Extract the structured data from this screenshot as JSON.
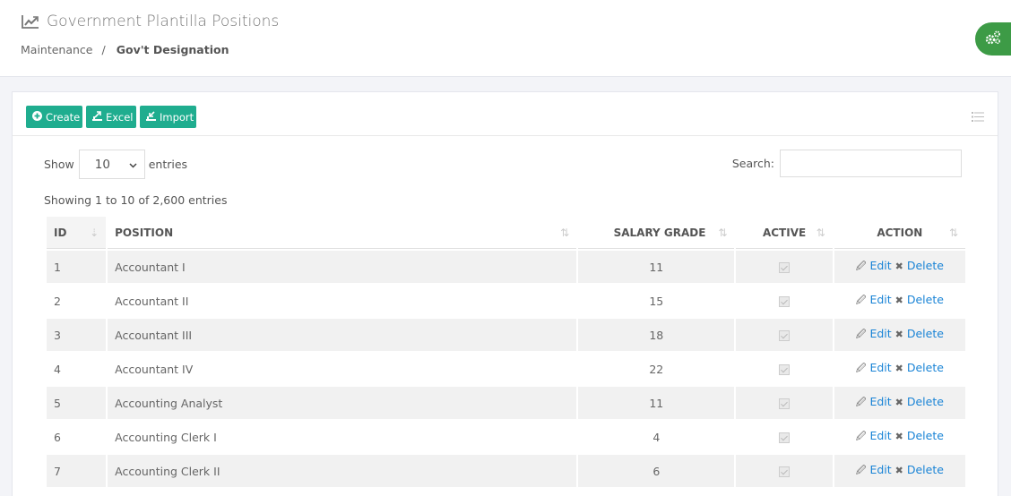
{
  "header": {
    "title": "Government Plantilla Positions",
    "title_icon": "line-chart-icon",
    "breadcrumb": [
      {
        "label": "Maintenance"
      },
      {
        "label": "Gov't Designation"
      }
    ],
    "breadcrumb_separator": "/"
  },
  "settings_toggle": {
    "icon": "gears-icon",
    "color": "#3d9b46"
  },
  "toolbar": {
    "create_label": "Create",
    "excel_label": "Excel",
    "import_label": "Import",
    "button_color": "#1fad8f",
    "columns_icon": "list-icon"
  },
  "length": {
    "show_label": "Show",
    "value": "10",
    "entries_label": "entries"
  },
  "search": {
    "label": "Search:",
    "value": "",
    "placeholder": ""
  },
  "info": "Showing 1 to 10 of 2,600 entries",
  "table": {
    "columns": [
      "ID",
      "POSITION",
      "SALARY GRADE",
      "ACTIVE",
      "ACTION"
    ],
    "edit_label": "Edit",
    "delete_label": "Delete",
    "link_color": "#1a84d6",
    "rows": [
      {
        "id": "1",
        "position": "Accountant I",
        "salary_grade": "11",
        "active": true
      },
      {
        "id": "2",
        "position": "Accountant II",
        "salary_grade": "15",
        "active": true
      },
      {
        "id": "3",
        "position": "Accountant III",
        "salary_grade": "18",
        "active": true
      },
      {
        "id": "4",
        "position": "Accountant IV",
        "salary_grade": "22",
        "active": true
      },
      {
        "id": "5",
        "position": "Accounting Analyst",
        "salary_grade": "11",
        "active": true
      },
      {
        "id": "6",
        "position": "Accounting Clerk I",
        "salary_grade": "4",
        "active": true
      },
      {
        "id": "7",
        "position": "Accounting Clerk II",
        "salary_grade": "6",
        "active": true
      }
    ]
  }
}
